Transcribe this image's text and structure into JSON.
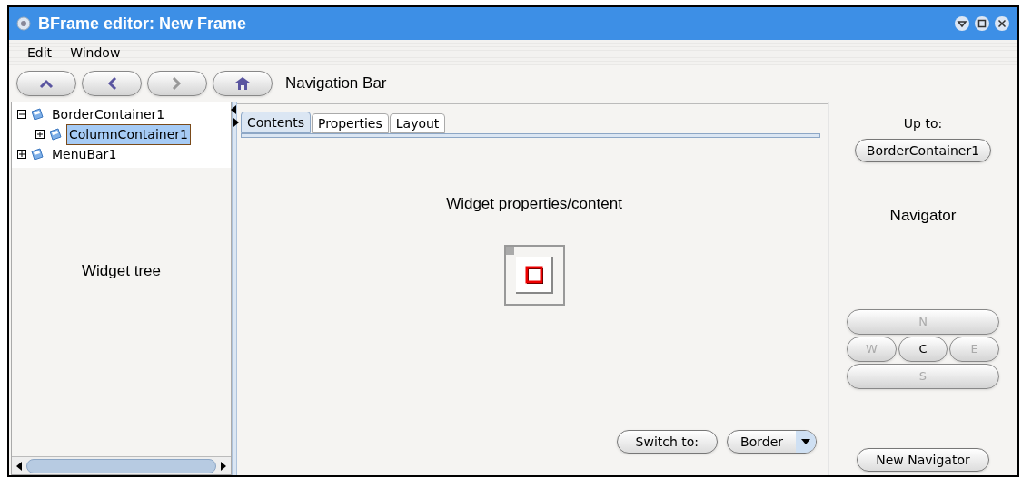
{
  "window": {
    "title": "BFrame editor: New Frame"
  },
  "menu": [
    "Edit",
    "Window"
  ],
  "toolbar": {
    "buttons": [
      {
        "kind": "up",
        "disabled": false
      },
      {
        "kind": "back",
        "disabled": false
      },
      {
        "kind": "forward",
        "disabled": true
      },
      {
        "kind": "home",
        "disabled": false
      }
    ],
    "label": "Navigation Bar"
  },
  "tree": {
    "items": [
      {
        "label": "BorderContainer1",
        "expanded": true,
        "selected": false,
        "children": [
          {
            "label": "ColumnContainer1",
            "expanded": false,
            "selected": true
          }
        ]
      },
      {
        "label": "MenuBar1",
        "expanded": false,
        "selected": false
      }
    ],
    "caption": "Widget tree"
  },
  "tabs": [
    {
      "label": "Contents",
      "selected": true
    },
    {
      "label": "Properties",
      "selected": false
    },
    {
      "label": "Layout",
      "selected": false
    }
  ],
  "content": {
    "caption": "Widget properties/content",
    "switch_label": "Switch to:",
    "layout_choice": "Border"
  },
  "navigator": {
    "up_label": "Up to:",
    "up_button": "BorderContainer1",
    "caption": "Navigator",
    "directions": [
      {
        "label": "N",
        "disabled": true
      },
      {
        "label": "W",
        "disabled": true
      },
      {
        "label": "C",
        "disabled": false
      },
      {
        "label": "E",
        "disabled": true
      },
      {
        "label": "S",
        "disabled": true
      }
    ],
    "new_button": "New Navigator"
  }
}
